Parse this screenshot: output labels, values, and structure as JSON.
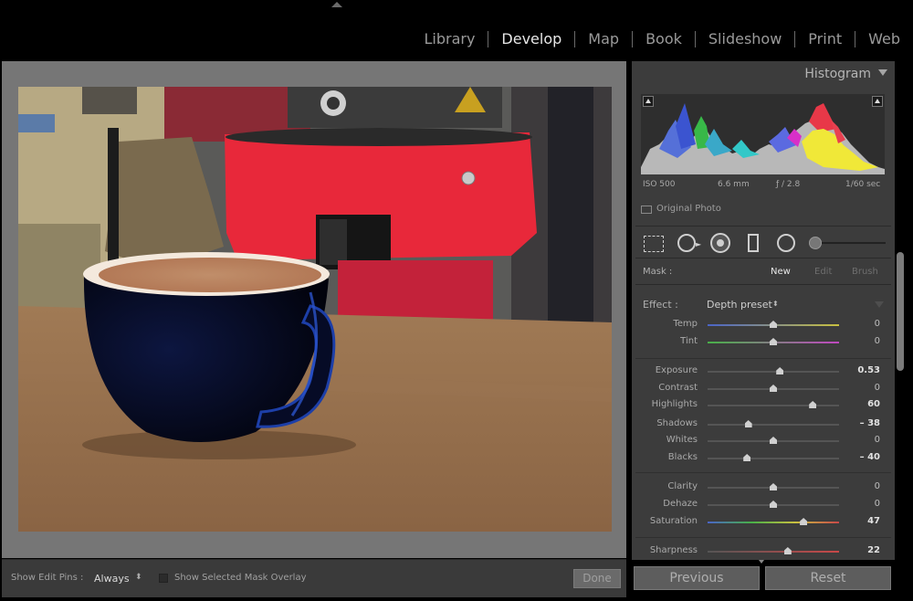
{
  "modules": [
    "Library",
    "Develop",
    "Map",
    "Book",
    "Slideshow",
    "Print",
    "Web"
  ],
  "active_module": "Develop",
  "bottom_bar": {
    "show_edit_pins_label": "Show Edit Pins :",
    "show_edit_pins_value": "Always",
    "updown_glyph": "⬍",
    "overlay_label": "Show Selected Mask Overlay",
    "done_label": "Done"
  },
  "histogram": {
    "title": "Histogram",
    "iso": "ISO 500",
    "focal_length": "6.6 mm",
    "aperture": "ƒ / 2.8",
    "shutter": "1/60 sec",
    "original_photo_label": "Original Photo"
  },
  "mask": {
    "label": "Mask :",
    "new": "New",
    "edit": "Edit",
    "brush": "Brush"
  },
  "effect": {
    "label": "Effect :",
    "value": "Depth preset",
    "updown_glyph": "⬍"
  },
  "sliders": [
    {
      "label": "Temp",
      "value": "0",
      "level": 0.5
    },
    {
      "label": "Tint",
      "value": "0",
      "level": 0.5
    },
    {
      "label": "Exposure",
      "value": "0.53",
      "level": 0.55
    },
    {
      "label": "Contrast",
      "value": "0",
      "level": 0.5
    },
    {
      "label": "Highlights",
      "value": "60",
      "level": 0.8
    },
    {
      "label": "Shadows",
      "value": "– 38",
      "level": 0.31
    },
    {
      "label": "Whites",
      "value": "0",
      "level": 0.5
    },
    {
      "label": "Blacks",
      "value": "– 40",
      "level": 0.3
    },
    {
      "label": "Clarity",
      "value": "0",
      "level": 0.5
    },
    {
      "label": "Dehaze",
      "value": "0",
      "level": 0.5
    },
    {
      "label": "Saturation",
      "value": "47",
      "level": 0.73
    },
    {
      "label": "Sharpness",
      "value": "22",
      "level": 0.61
    }
  ],
  "buttons": {
    "previous": "Previous",
    "reset": "Reset"
  },
  "icons": {
    "top_arrow": "triangle-up-icon",
    "histogram_collapse": "triangle-down-icon",
    "tools": [
      "crop-icon",
      "spot-removal-icon",
      "red-eye-icon",
      "graduated-filter-icon",
      "radial-filter-icon",
      "brush-size-slider"
    ]
  }
}
